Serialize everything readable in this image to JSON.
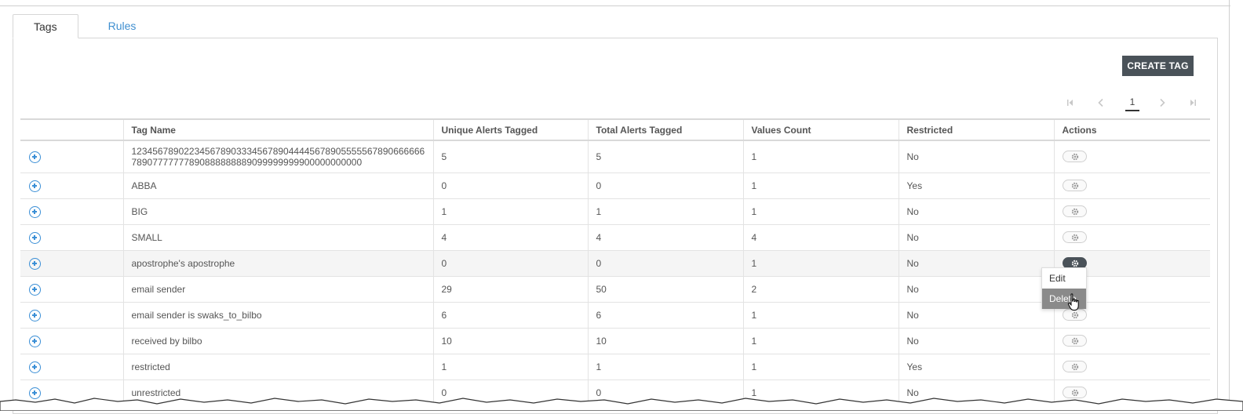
{
  "tabs": [
    {
      "label": "Tags",
      "active": true
    },
    {
      "label": "Rules",
      "active": false
    }
  ],
  "toolbar": {
    "create_label": "CREATE TAG"
  },
  "pagination": {
    "current_page": "1"
  },
  "table": {
    "headers": [
      "",
      "Tag Name",
      "Unique Alerts Tagged",
      "Total Alerts Tagged",
      "Values Count",
      "Restricted",
      "Actions"
    ],
    "rows": [
      {
        "name": "1234567890223456789033345678904444567890555556789066666678907777777890888888889099999999900000000000",
        "unique": "5",
        "total": "5",
        "values": "1",
        "restricted": "No"
      },
      {
        "name": "ABBA",
        "unique": "0",
        "total": "0",
        "values": "1",
        "restricted": "Yes"
      },
      {
        "name": "BIG",
        "unique": "1",
        "total": "1",
        "values": "1",
        "restricted": "No"
      },
      {
        "name": "SMALL",
        "unique": "4",
        "total": "4",
        "values": "4",
        "restricted": "No"
      },
      {
        "name": "apostrophe's apostrophe",
        "unique": "0",
        "total": "0",
        "values": "1",
        "restricted": "No"
      },
      {
        "name": "email sender",
        "unique": "29",
        "total": "50",
        "values": "2",
        "restricted": "No"
      },
      {
        "name": "email sender is swaks_to_bilbo",
        "unique": "6",
        "total": "6",
        "values": "1",
        "restricted": "No"
      },
      {
        "name": "received by bilbo",
        "unique": "10",
        "total": "10",
        "values": "1",
        "restricted": "No"
      },
      {
        "name": "restricted",
        "unique": "1",
        "total": "1",
        "values": "1",
        "restricted": "Yes"
      },
      {
        "name": "unrestricted",
        "unique": "0",
        "total": "0",
        "values": "1",
        "restricted": "No"
      }
    ]
  },
  "context_menu": {
    "items": [
      {
        "label": "Edit",
        "highlighted": false
      },
      {
        "label": "Delete",
        "highlighted": true
      }
    ]
  },
  "icons": {
    "expand": "plus-circle-icon",
    "actions": "gear-icon",
    "first": "first-page-icon",
    "prev": "chevron-left-icon",
    "next": "chevron-right-icon",
    "last": "last-page-icon",
    "cursor": "hand-pointer-icon"
  },
  "colors": {
    "accent": "#3f8fd0",
    "button_dark": "#4a5259",
    "menu_highlight": "#8a8a8a"
  }
}
